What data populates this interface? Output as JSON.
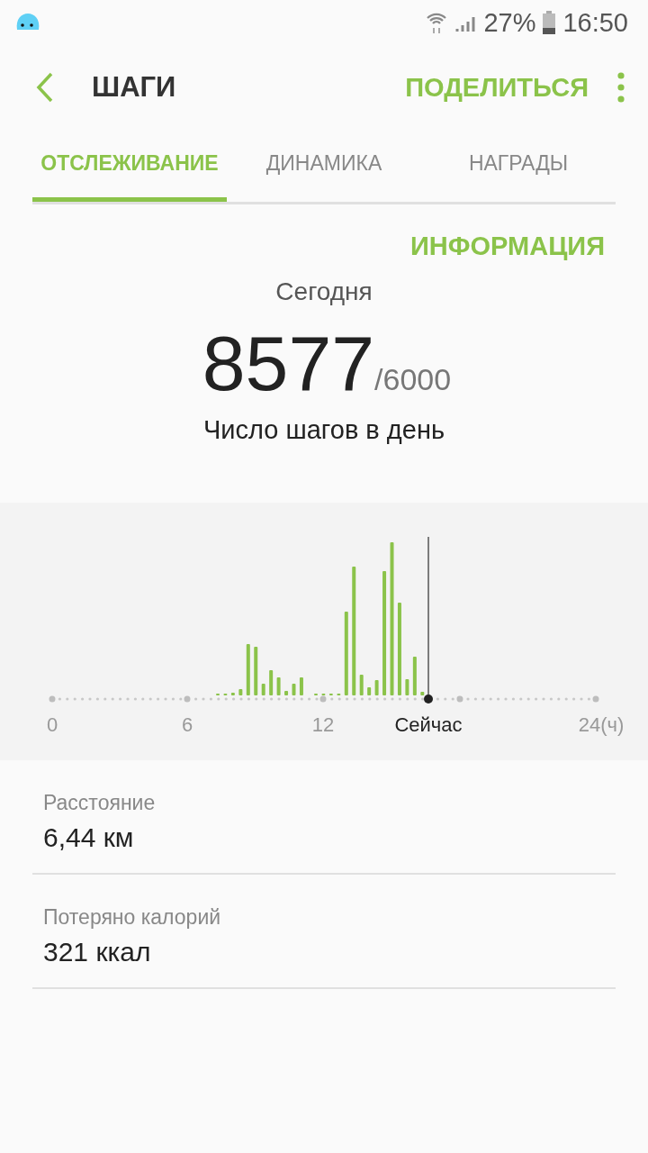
{
  "status_bar": {
    "battery": "27%",
    "time": "16:50"
  },
  "header": {
    "title": "ШАГИ",
    "share": "ПОДЕЛИТЬСЯ"
  },
  "tabs": [
    {
      "label": "ОТСЛЕЖИВАНИЕ",
      "selected": true
    },
    {
      "label": "ДИНАМИКА",
      "selected": false
    },
    {
      "label": "НАГРАДЫ",
      "selected": false
    }
  ],
  "info_link": "ИНФОРМАЦИЯ",
  "summary": {
    "period": "Сегодня",
    "steps": "8577",
    "goal": "/6000",
    "caption": "Число шагов в день"
  },
  "chart": {
    "x_labels": [
      "0",
      "6",
      "12",
      "24(ч)"
    ],
    "now_label": "Сейчас"
  },
  "stats": [
    {
      "label": "Расстояние",
      "value": "6,44 км"
    },
    {
      "label": "Потеряно калорий",
      "value": "321 ккал"
    }
  ]
}
